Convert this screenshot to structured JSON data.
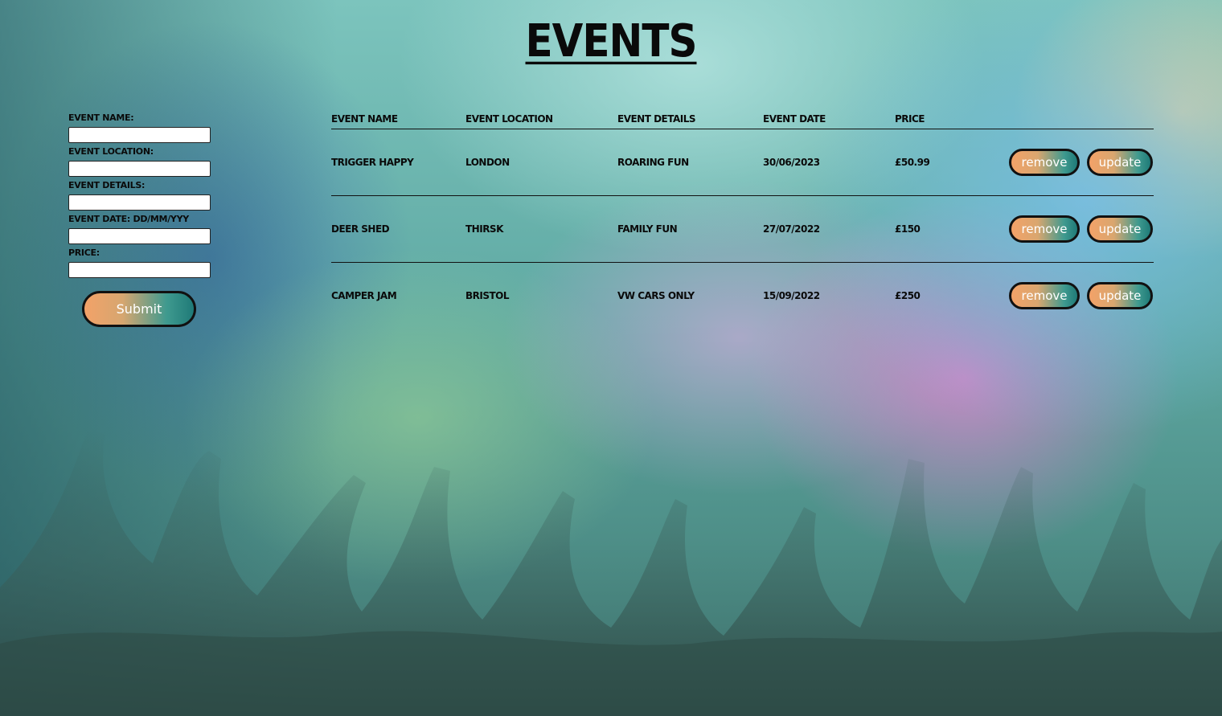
{
  "page": {
    "title": "Events"
  },
  "form": {
    "fields": [
      {
        "label": "Event Name:",
        "value": ""
      },
      {
        "label": "Event Location:",
        "value": ""
      },
      {
        "label": "Event Details:",
        "value": ""
      },
      {
        "label": "Event Date: dd/mm/yyy",
        "value": ""
      },
      {
        "label": "Price:",
        "value": ""
      }
    ],
    "submit_label": "Submit"
  },
  "table": {
    "headers": [
      "Event Name",
      "Event Location",
      "Event Details",
      "Event Date",
      "Price"
    ],
    "rows": [
      {
        "name": "Trigger Happy",
        "location": "London",
        "details": "Roaring fun",
        "date": "30/06/2023",
        "price": "£50.99"
      },
      {
        "name": "Deer Shed",
        "location": "Thirsk",
        "details": "Family fun",
        "date": "27/07/2022",
        "price": "£150"
      },
      {
        "name": "Camper Jam",
        "location": "Bristol",
        "details": "VW cars only",
        "date": "15/09/2022",
        "price": "£250"
      }
    ],
    "remove_label": "remove",
    "update_label": "update"
  },
  "theme": {
    "button_gradient_start": "#f3a268",
    "button_gradient_end": "#1f7a78",
    "text_color": "#0a0a0a"
  }
}
